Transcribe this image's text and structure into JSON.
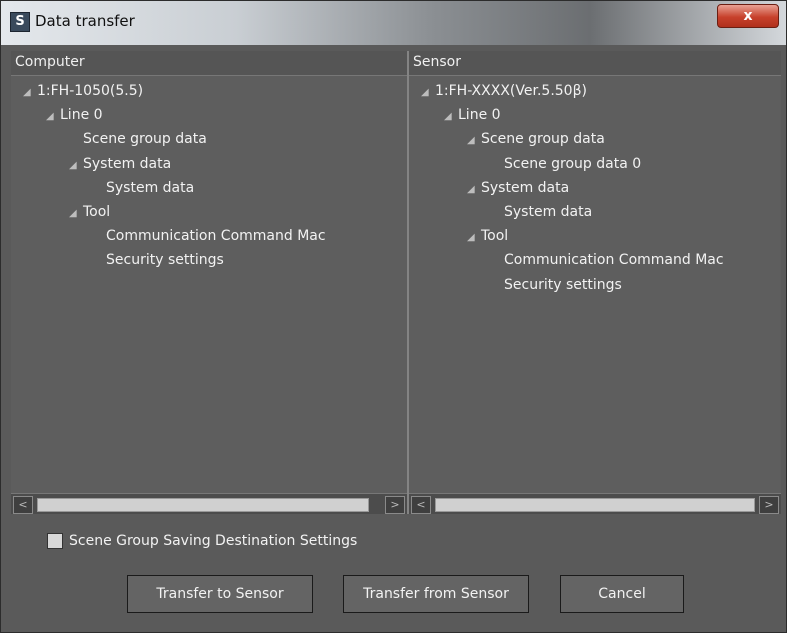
{
  "window": {
    "title": "Data transfer",
    "close_label": "x",
    "icon": "app-logo-icon",
    "icon_glyph": "S"
  },
  "computer_pane": {
    "header": "Computer",
    "tree": [
      {
        "label": "1:FH-1050(5.5)",
        "expanded": true,
        "depth": 0
      },
      {
        "label": "Line 0",
        "expanded": true,
        "depth": 1
      },
      {
        "label": "Scene group data",
        "expanded": null,
        "depth": 2
      },
      {
        "label": "System data",
        "expanded": true,
        "depth": 2
      },
      {
        "label": "System data",
        "expanded": null,
        "depth": 3
      },
      {
        "label": "Tool",
        "expanded": true,
        "depth": 2
      },
      {
        "label": "Communication Command Mac",
        "expanded": null,
        "depth": 3
      },
      {
        "label": "Security settings",
        "expanded": null,
        "depth": 3
      }
    ]
  },
  "sensor_pane": {
    "header": "Sensor",
    "tree": [
      {
        "label": "1:FH-XXXX(Ver.5.50β)",
        "expanded": true,
        "depth": 0
      },
      {
        "label": "Line 0",
        "expanded": true,
        "depth": 1
      },
      {
        "label": "Scene group data",
        "expanded": true,
        "depth": 2
      },
      {
        "label": "Scene group data 0",
        "expanded": null,
        "depth": 3
      },
      {
        "label": "System data",
        "expanded": true,
        "depth": 2
      },
      {
        "label": "System data",
        "expanded": null,
        "depth": 3
      },
      {
        "label": "Tool",
        "expanded": true,
        "depth": 2
      },
      {
        "label": "Communication Command Mac",
        "expanded": null,
        "depth": 3
      },
      {
        "label": "Security settings",
        "expanded": null,
        "depth": 3
      }
    ]
  },
  "scene_group_checkbox": {
    "label": "Scene Group Saving Destination Settings",
    "checked": false
  },
  "buttons": {
    "transfer_to": "Transfer to Sensor",
    "transfer_from": "Transfer from Sensor",
    "cancel": "Cancel"
  },
  "icons": {
    "expander": "expanded-triangle-icon",
    "scroll_left": "scroll-left-arrow-icon",
    "scroll_right": "scroll-right-arrow-icon"
  }
}
